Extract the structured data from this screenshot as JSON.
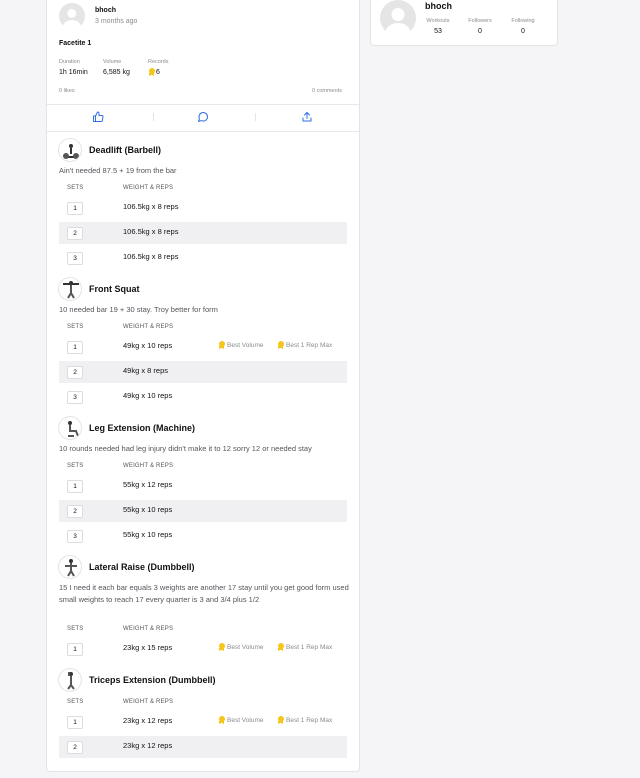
{
  "post": {
    "username": "bhoch",
    "time_ago": "3 months ago",
    "workout_title": "Facetite 1",
    "stats": [
      {
        "label": "Duration",
        "value": "1h 16min"
      },
      {
        "label": "Volume",
        "value": "6,585 kg"
      },
      {
        "label": "Records",
        "value": "6"
      }
    ],
    "likes": "0 likes",
    "comments": "0 comments",
    "actions": [
      "thumbs-up-icon",
      "comment-icon",
      "share-icon"
    ],
    "col_sets": "SETS",
    "col_weight": "WEIGHT & REPS",
    "pr_volume": "Best Volume",
    "pr_1rm": "Best 1 Rep Max",
    "exercises": [
      {
        "name": "Deadlift (Barbell)",
        "note": "Ain't needed 87.5 + 19 from the bar",
        "sets": [
          {
            "n": "1",
            "val": "106.5kg x 8 reps"
          },
          {
            "n": "2",
            "val": "106.5kg x 8 reps"
          },
          {
            "n": "3",
            "val": "106.5kg x 8 reps"
          }
        ]
      },
      {
        "name": "Front Squat",
        "note": "10 needed bar 19 + 30 stay. Troy better for form",
        "sets": [
          {
            "n": "1",
            "val": "49kg x 10 reps",
            "pr": true
          },
          {
            "n": "2",
            "val": "49kg x 8 reps"
          },
          {
            "n": "3",
            "val": "49kg x 10 reps"
          }
        ]
      },
      {
        "name": "Leg Extension (Machine)",
        "note": "10 rounds needed had leg injury didn't make it to 12 sorry 12 or needed stay",
        "sets": [
          {
            "n": "1",
            "val": "55kg x 12 reps"
          },
          {
            "n": "2",
            "val": "55kg x 10 reps"
          },
          {
            "n": "3",
            "val": "55kg x 10 reps"
          }
        ]
      },
      {
        "name": "Lateral Raise (Dumbbell)",
        "note": "15 I need it each bar equals 3 weights are another 17 stay until you get good form used small weights to reach 17 every quarter is 3 and 3/4 plus 1/2",
        "sets": [
          {
            "n": "1",
            "val": "23kg x 15 reps",
            "pr": true
          }
        ]
      },
      {
        "name": "Triceps Extension (Dumbbell)",
        "note": "",
        "sets": [
          {
            "n": "1",
            "val": "23kg x 12 reps",
            "pr": true
          },
          {
            "n": "2",
            "val": "23kg x 12 reps"
          }
        ]
      }
    ]
  },
  "profile": {
    "username": "bhoch",
    "stats": [
      {
        "label": "Workouts",
        "value": "53"
      },
      {
        "label": "Followers",
        "value": "0"
      },
      {
        "label": "Following",
        "value": "0"
      }
    ]
  },
  "colors": {
    "accent": "#2f6fe4",
    "medal": "#f5c518",
    "alt_row": "#f0f0f2"
  }
}
